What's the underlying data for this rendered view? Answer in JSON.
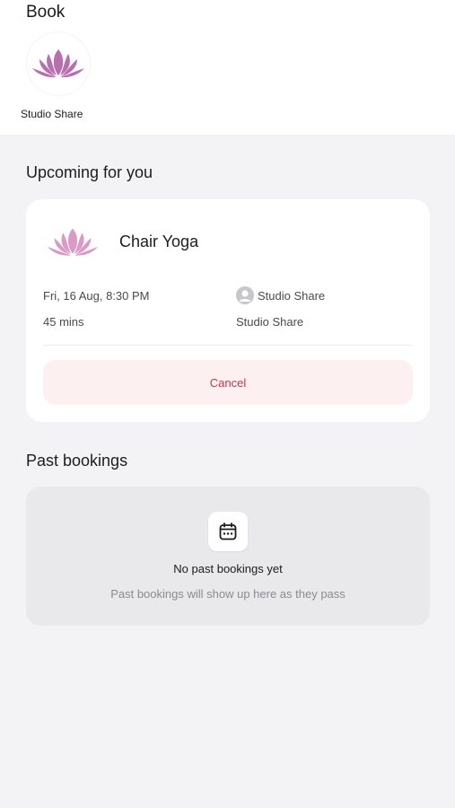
{
  "header": {
    "title": "Book",
    "studio": {
      "name": "Studio Share",
      "logo_icon": "lotus-icon",
      "logo_color": "#b86fb0"
    }
  },
  "upcoming": {
    "title": "Upcoming for you",
    "booking": {
      "class_name": "Chair Yoga",
      "datetime": "Fri, 16 Aug, 8:30 PM",
      "duration": "45 mins",
      "host": "Studio Share",
      "location": "Studio Share",
      "cancel_label": "Cancel",
      "cancel_color": "#c0394a"
    }
  },
  "past": {
    "title": "Past bookings",
    "empty_title": "No past bookings yet",
    "empty_subtitle": "Past bookings will show up here as they pass",
    "empty_icon": "calendar-icon"
  }
}
